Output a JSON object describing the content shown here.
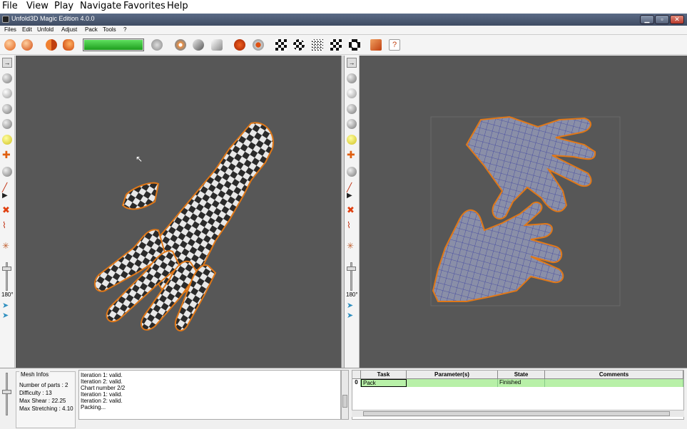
{
  "outer_menu": [
    "File",
    "View",
    "Play",
    "Navigate",
    "Favorites",
    "Help"
  ],
  "app": {
    "title": "Unfold3D Magic Edition 4.0.0",
    "window_buttons": [
      "minimize",
      "maximize",
      "close"
    ]
  },
  "app_menu": [
    "Files",
    "Edit",
    "Unfold",
    "Adjust",
    "Pack",
    "Tools",
    "?"
  ],
  "toolbar": {
    "progress_fraction": 1.0,
    "icons": [
      "orange-sphere-icon",
      "orange-sphere-alt-icon",
      "orange-split-icon",
      "orange-unfold-icon",
      "play-icon",
      "cd-icon",
      "chain-icon",
      "puzzle-icon",
      "no-stretch-icon",
      "stop-icon",
      "checker-flag-icon",
      "checker-ball-icon",
      "checker-small-icon",
      "checker-medium-icon",
      "checker-large-icon",
      "pack-icon",
      "help-icon"
    ]
  },
  "side_toolbar": {
    "icons": [
      "arrow-right-icon",
      "sphere-icon",
      "globe-icon",
      "grid-sphere-icon",
      "checker-sphere-icon",
      "light-bulb-icon",
      "move-icon",
      "eye-icon",
      "line-icon",
      "triangle-icon",
      "cut-icon",
      "weld-icon",
      "relax-icon"
    ],
    "angle_label": "180°"
  },
  "mesh_infos": {
    "title": "Mesh Infos",
    "lines": [
      "Number of parts : 2",
      "Difficulty   : 13",
      "Max Shear   : 22.25",
      "Max Stretching : 4.10"
    ]
  },
  "log_lines": [
    "Iteration 1: valid.",
    "Iteration 2: valid.",
    "Chart number 2/2",
    "Iteration 1: valid.",
    "Iteration 2: valid.",
    "Packing..."
  ],
  "task_table": {
    "columns": [
      "Task",
      "Parameter(s)",
      "State",
      "Comments"
    ],
    "rows": [
      {
        "index": "0",
        "task": "Pack",
        "params": "",
        "state": "Finished",
        "comments": ""
      }
    ]
  }
}
